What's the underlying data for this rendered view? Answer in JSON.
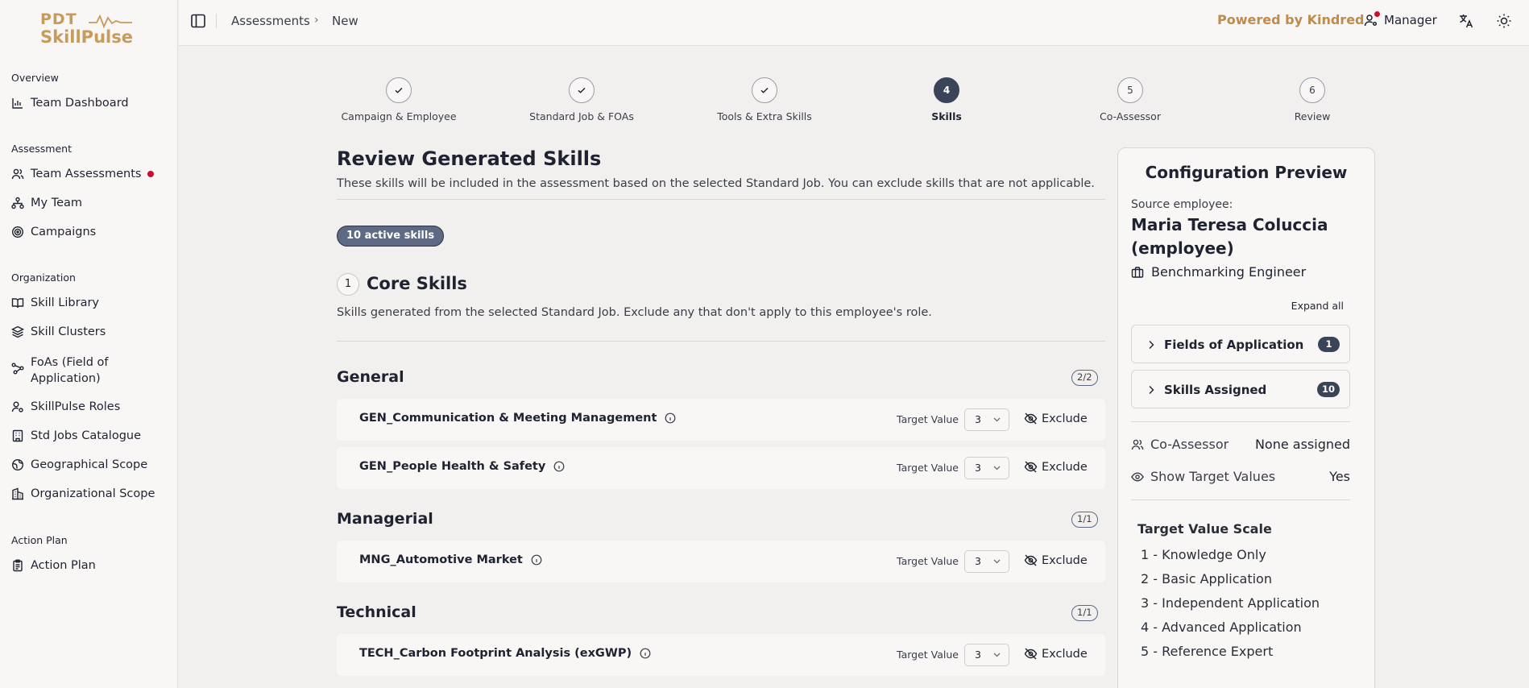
{
  "brand": {
    "line1": "PDT",
    "line2": "SkillPulse"
  },
  "sidebar": {
    "sections": [
      {
        "title": "Overview",
        "items": [
          {
            "label": "Team Dashboard"
          }
        ]
      },
      {
        "title": "Assessment",
        "items": [
          {
            "label": "Team Assessments"
          },
          {
            "label": "My Team"
          },
          {
            "label": "Campaigns"
          }
        ]
      },
      {
        "title": "Organization",
        "items": [
          {
            "label": "Skill Library"
          },
          {
            "label": "Skill Clusters"
          },
          {
            "label": "FoAs (Field of Application)"
          },
          {
            "label": "SkillPulse Roles"
          },
          {
            "label": "Std Jobs Catalogue"
          },
          {
            "label": "Geographical Scope"
          },
          {
            "label": "Organizational Scope"
          }
        ]
      },
      {
        "title": "Action Plan",
        "items": [
          {
            "label": "Action Plan"
          }
        ]
      }
    ]
  },
  "header": {
    "breadcrumb": [
      "Assessments",
      "New"
    ],
    "powered_by": "Powered by Kindred",
    "role": "Manager"
  },
  "stepper": [
    {
      "label": "Campaign & Employee",
      "state": "done"
    },
    {
      "label": "Standard Job & FOAs",
      "state": "done"
    },
    {
      "label": "Tools & Extra Skills",
      "state": "done"
    },
    {
      "label": "Skills",
      "number": "4",
      "state": "active"
    },
    {
      "label": "Co-Assessor",
      "number": "5",
      "state": "todo"
    },
    {
      "label": "Review",
      "number": "6",
      "state": "todo"
    }
  ],
  "main": {
    "title": "Review Generated Skills",
    "subtitle": "These skills will be included in the assessment based on the selected Standard Job. You can exclude skills that are not applicable.",
    "active_badge": "10 active skills",
    "section": {
      "number": "1",
      "title": "Core Skills",
      "description": "Skills generated from the selected Standard Job. Exclude any that don't apply to this employee's role."
    },
    "target_label": "Target Value",
    "exclude_label": "Exclude",
    "groups": [
      {
        "title": "General",
        "count": "2/2",
        "skills": [
          {
            "name": "GEN_Communication & Meeting Management",
            "target": "3"
          },
          {
            "name": "GEN_People Health & Safety",
            "target": "3"
          }
        ]
      },
      {
        "title": "Managerial",
        "count": "1/1",
        "skills": [
          {
            "name": "MNG_Automotive Market",
            "target": "3"
          }
        ]
      },
      {
        "title": "Technical",
        "count": "1/1",
        "skills": [
          {
            "name": "TECH_Carbon Footprint Analysis (exGWP)",
            "target": "3"
          }
        ]
      }
    ]
  },
  "config": {
    "title": "Configuration Preview",
    "source_label": "Source employee:",
    "employee": "Maria Teresa Coluccia (employee)",
    "job": "Benchmarking Engineer",
    "expand_all": "Expand all",
    "accordions": [
      {
        "label": "Fields of Application",
        "count": "1"
      },
      {
        "label": "Skills Assigned",
        "count": "10"
      }
    ],
    "co_assessor_label": "Co-Assessor",
    "co_assessor_value": "None assigned",
    "show_targets_label": "Show Target Values",
    "show_targets_value": "Yes",
    "scale_title": "Target Value Scale",
    "scale": [
      "1 - Knowledge Only",
      "2 - Basic Application",
      "3 - Independent Application",
      "4 - Advanced Application",
      "5 - Reference Expert"
    ]
  },
  "colors": {
    "accent": "#c89a5c",
    "active_step": "#3a4459",
    "alert": "#c8102e"
  }
}
